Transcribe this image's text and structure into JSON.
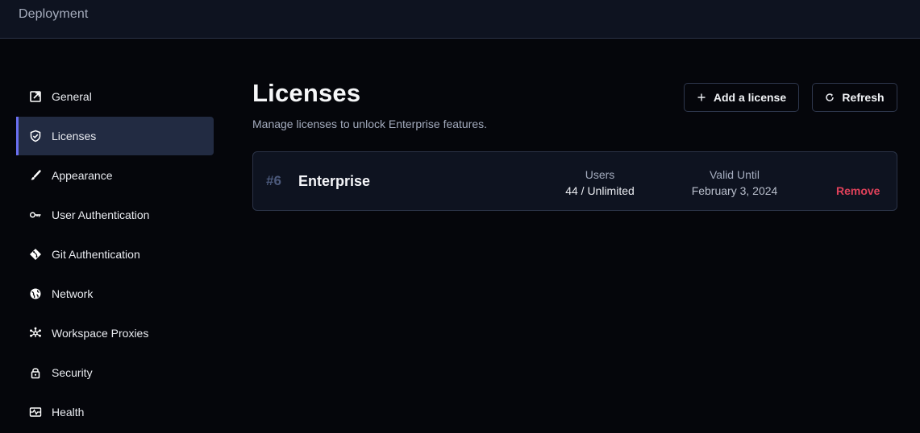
{
  "topbar": {
    "title": "Deployment"
  },
  "sidebar": {
    "items": [
      {
        "label": "General",
        "icon": "external-link-icon",
        "active": false
      },
      {
        "label": "Licenses",
        "icon": "shield-check-icon",
        "active": true
      },
      {
        "label": "Appearance",
        "icon": "brush-icon",
        "active": false
      },
      {
        "label": "User Authentication",
        "icon": "key-icon",
        "active": false
      },
      {
        "label": "Git Authentication",
        "icon": "git-icon",
        "active": false
      },
      {
        "label": "Network",
        "icon": "globe-icon",
        "active": false
      },
      {
        "label": "Workspace Proxies",
        "icon": "hub-icon",
        "active": false
      },
      {
        "label": "Security",
        "icon": "lock-icon",
        "active": false
      },
      {
        "label": "Health",
        "icon": "monitor-heart-icon",
        "active": false
      }
    ]
  },
  "main": {
    "title": "Licenses",
    "subtitle": "Manage licenses to unlock Enterprise features.",
    "add_button": {
      "label": "Add a license",
      "icon": "plus-icon"
    },
    "refresh_button": {
      "label": "Refresh",
      "icon": "refresh-icon"
    },
    "licenses": [
      {
        "id": "#6",
        "name": "Enterprise",
        "users_label": "Users",
        "users_value": "44 / Unlimited",
        "valid_label": "Valid Until",
        "valid_value": "February 3, 2024",
        "remove_label": "Remove"
      }
    ]
  },
  "colors": {
    "accent": "#6a6ff0",
    "danger": "#e0415a",
    "active_bg": "#222b42",
    "card_bg": "#0e1320"
  }
}
